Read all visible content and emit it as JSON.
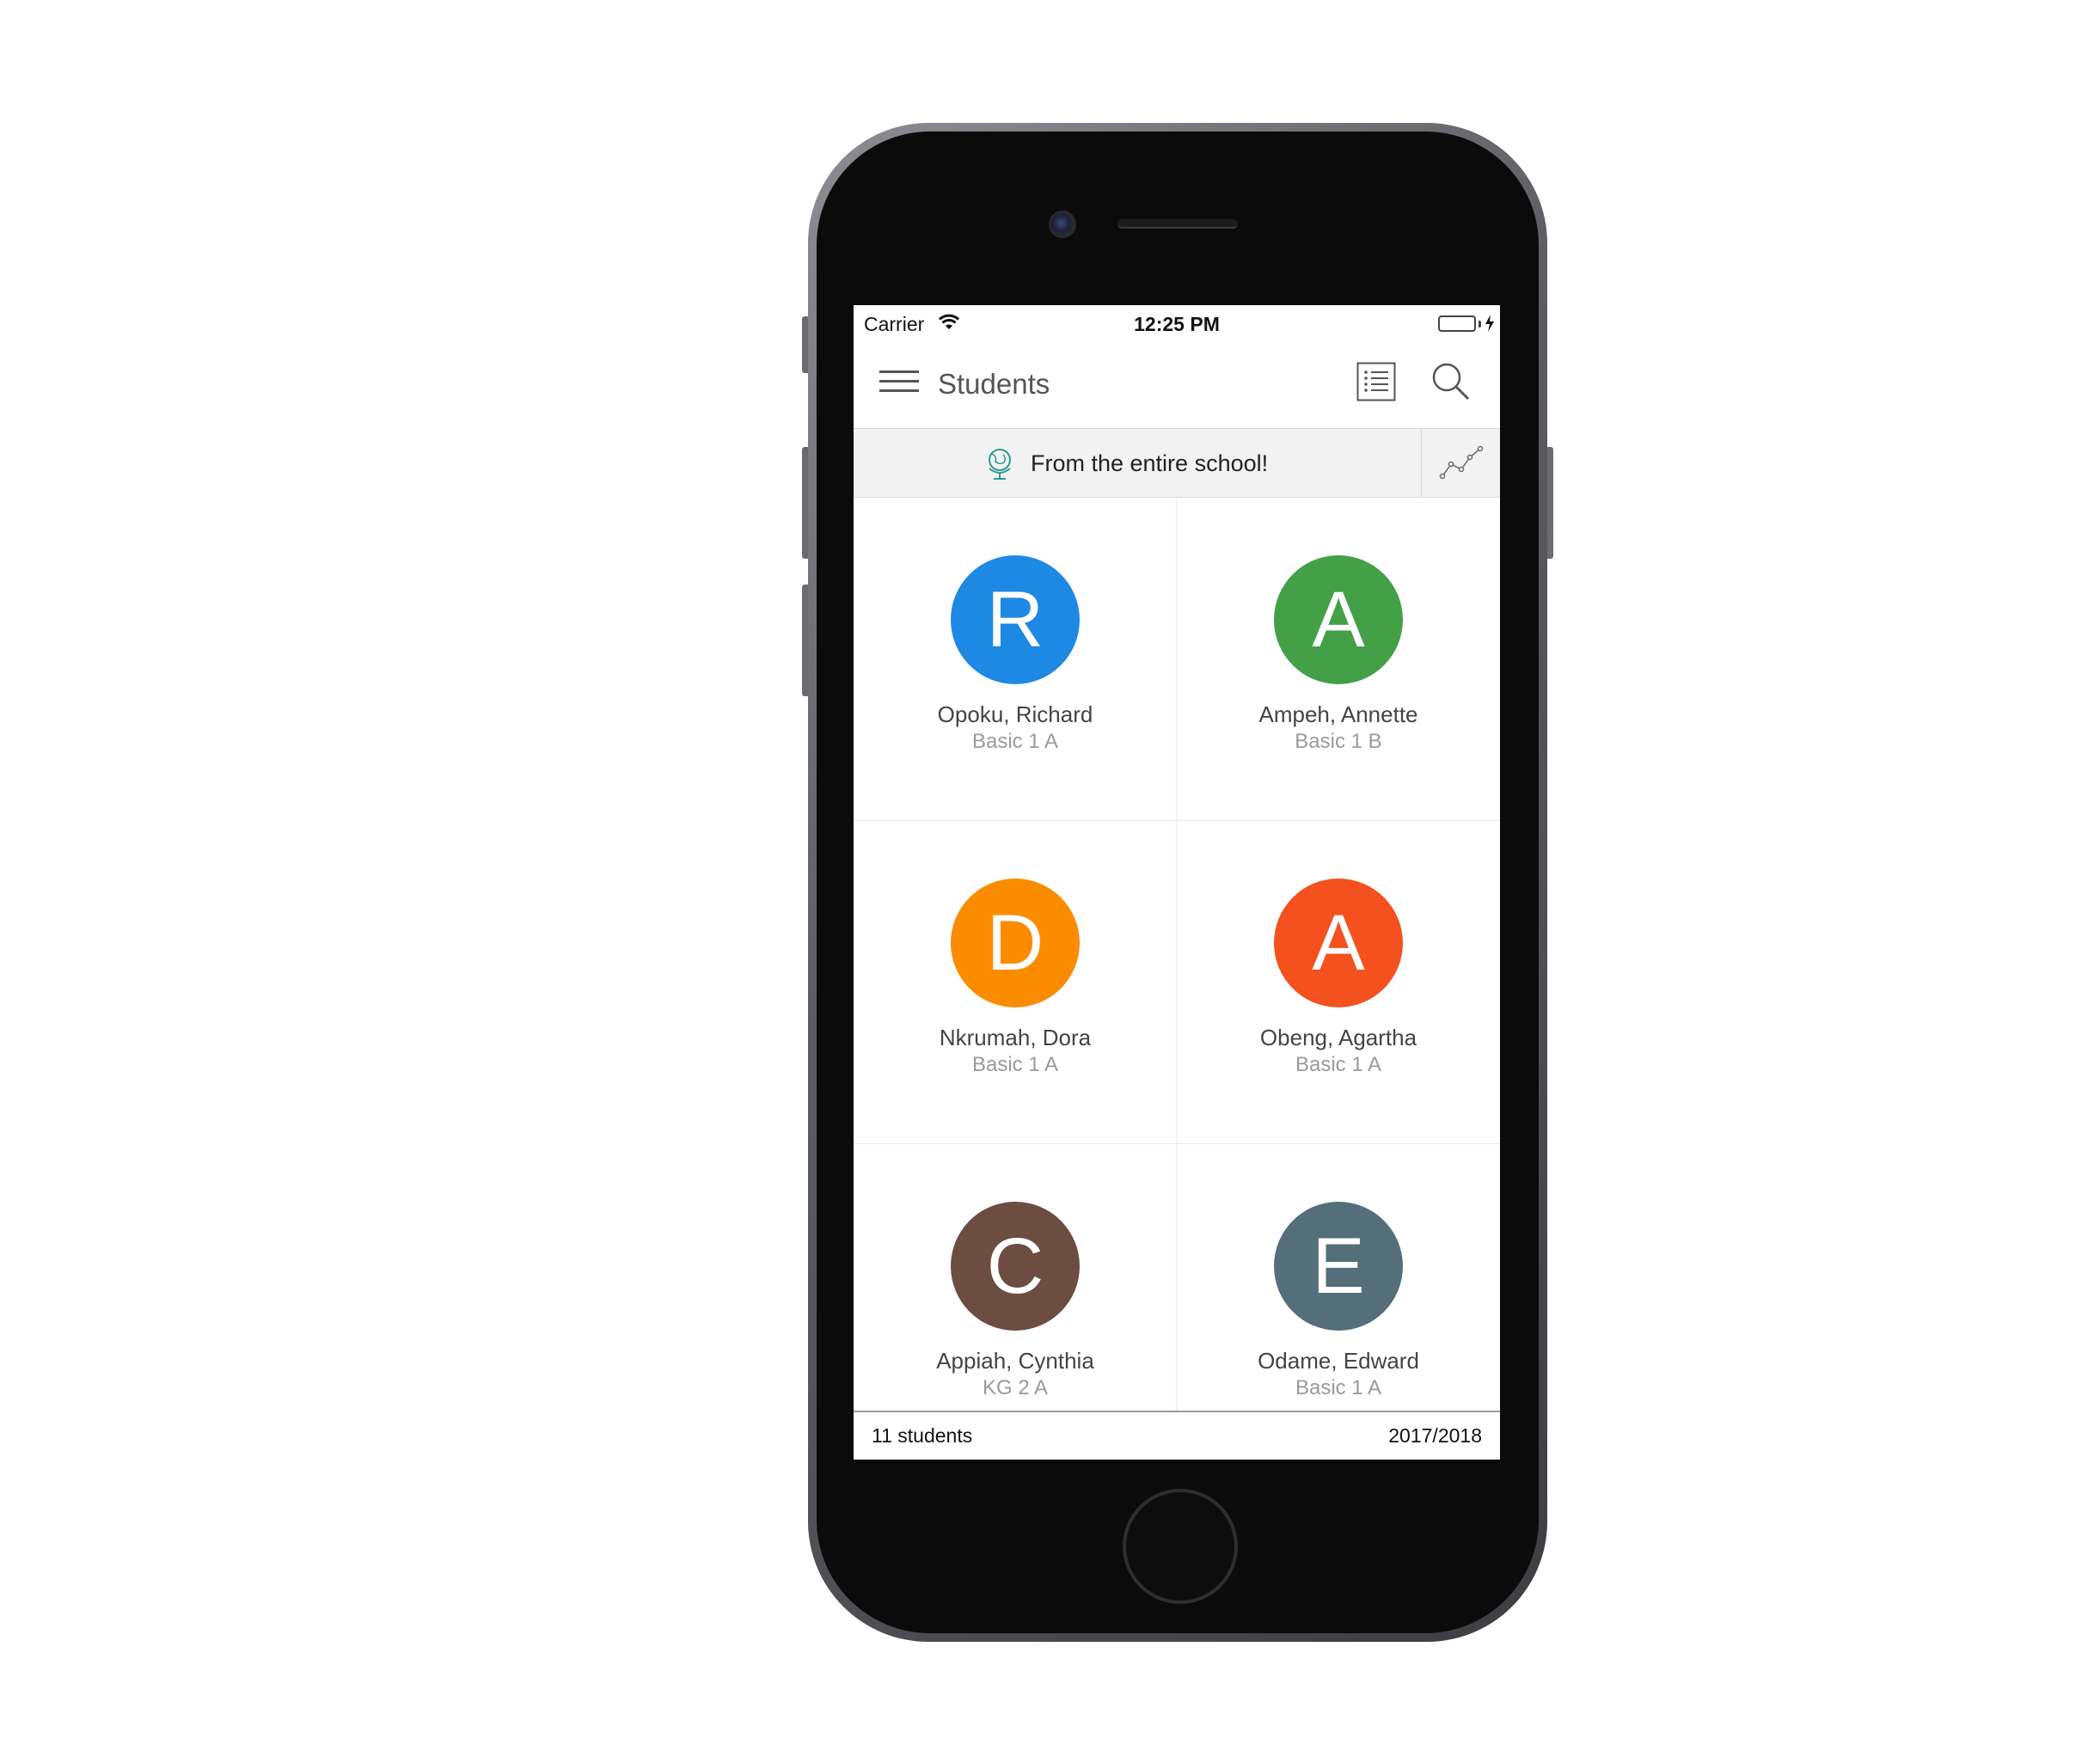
{
  "status_bar": {
    "carrier": "Carrier",
    "time": "12:25 PM",
    "battery_color": "#4cd964"
  },
  "nav": {
    "title": "Students",
    "menu_icon": "hamburger-menu-icon",
    "list_icon": "list-view-icon",
    "search_icon": "search-icon"
  },
  "scope": {
    "label": "From the entire school!",
    "icon": "globe-icon",
    "chart_icon": "line-chart-icon",
    "icon_color": "#2a9d8f"
  },
  "students": [
    {
      "initial": "R",
      "name": "Opoku, Richard",
      "class": "Basic 1 A",
      "color": "#1e88e5"
    },
    {
      "initial": "A",
      "name": "Ampeh, Annette",
      "class": "Basic 1 B",
      "color": "#43a047"
    },
    {
      "initial": "D",
      "name": "Nkrumah, Dora",
      "class": "Basic 1 A",
      "color": "#fb8c00"
    },
    {
      "initial": "A",
      "name": "Obeng, Agartha",
      "class": "Basic 1 A",
      "color": "#f4511e"
    },
    {
      "initial": "C",
      "name": "Appiah, Cynthia",
      "class": "KG 2 A",
      "color": "#6d4c41"
    },
    {
      "initial": "E",
      "name": "Odame, Edward",
      "class": "Basic 1 A",
      "color": "#546e7a"
    }
  ],
  "footer": {
    "count": "11 students",
    "year": "2017/2018"
  }
}
